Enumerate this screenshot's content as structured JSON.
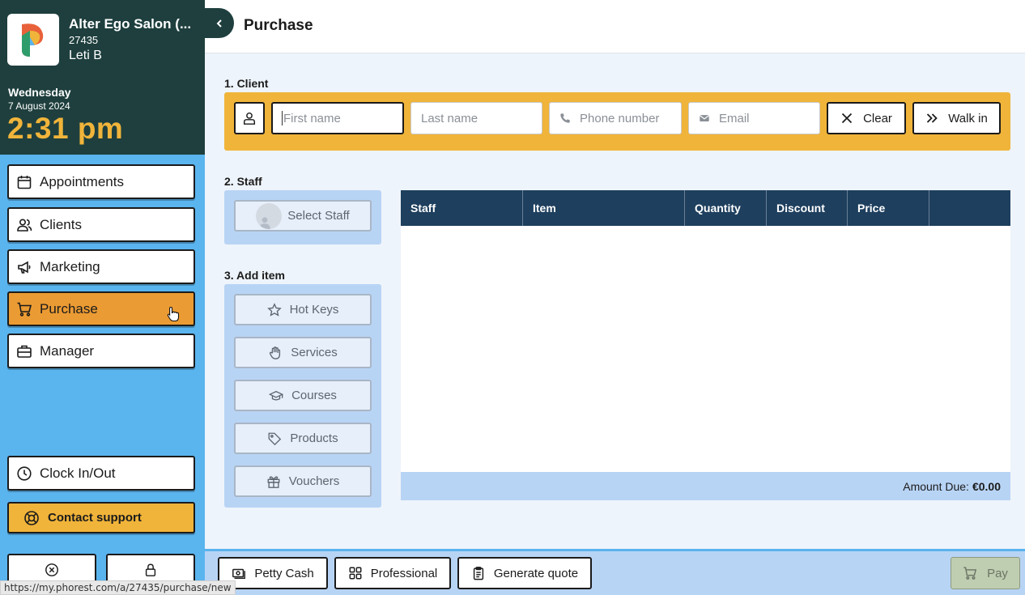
{
  "sidebar": {
    "salon_name": "Alter Ego Salon (...",
    "salon_id": "27435",
    "user_name": "Leti B",
    "day": "Wednesday",
    "date": "7 August 2024",
    "time": "2:31 pm",
    "nav": {
      "appointments": "Appointments",
      "clients": "Clients",
      "marketing": "Marketing",
      "purchase": "Purchase",
      "manager": "Manager"
    },
    "clock": "Clock In/Out",
    "support": "Contact support",
    "status_url": "https://my.phorest.com/a/27435/purchase/new"
  },
  "header": {
    "title": "Purchase"
  },
  "client": {
    "section_label": "1. Client",
    "first_name_placeholder": "First name",
    "last_name_placeholder": "Last name",
    "phone_placeholder": "Phone number",
    "email_placeholder": "Email",
    "clear_label": "Clear",
    "walkin_label": "Walk in"
  },
  "staff": {
    "section_label": "2. Staff",
    "select_label": "Select Staff"
  },
  "add_item": {
    "section_label": "3. Add item",
    "hot_keys": "Hot Keys",
    "services": "Services",
    "courses": "Courses",
    "products": "Products",
    "vouchers": "Vouchers"
  },
  "table": {
    "columns": [
      "Staff",
      "Item",
      "Quantity",
      "Discount",
      "Price",
      ""
    ],
    "amount_due_label": "Amount Due:",
    "amount_due_value": "€0.00"
  },
  "footer": {
    "petty_cash": "Petty Cash",
    "professional": "Professional",
    "generate_quote": "Generate quote",
    "pay": "Pay"
  },
  "colors": {
    "sidebar_dark": "#1e3f3e",
    "sidebar_blue": "#5ab4ee",
    "accent_yellow": "#f0b43a",
    "active_orange": "#eb9b33",
    "table_header": "#1e3f5e",
    "panel_blue": "#b8d4f5"
  }
}
